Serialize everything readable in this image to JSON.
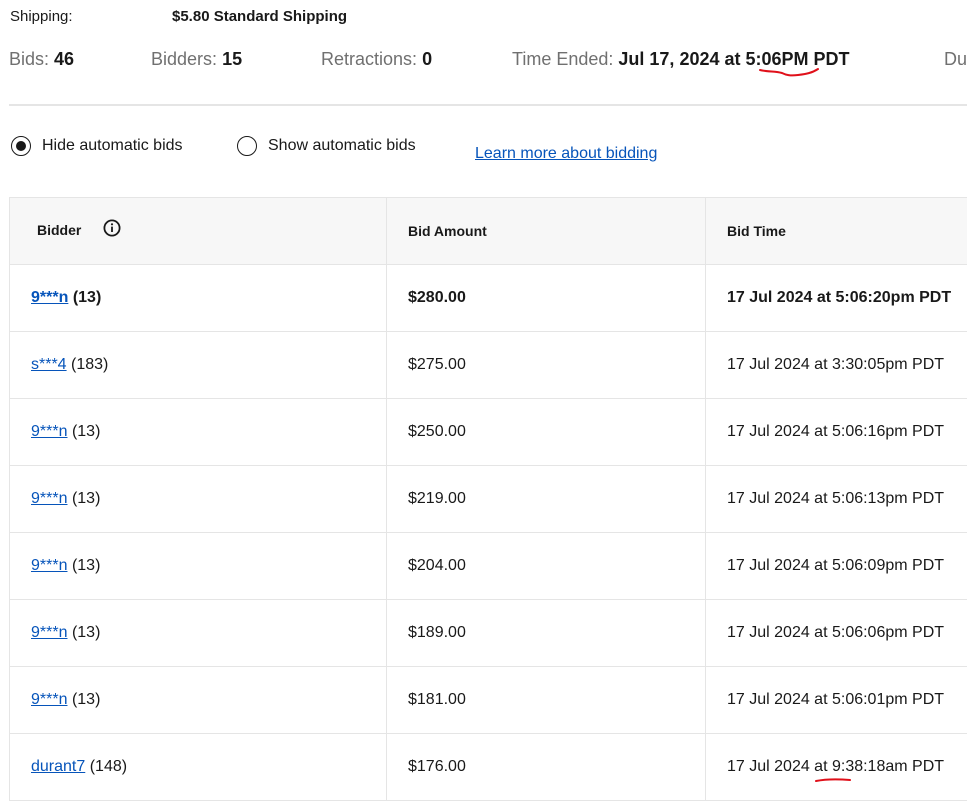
{
  "shipping": {
    "label": "Shipping:",
    "value": "$5.80 Standard Shipping"
  },
  "stats": {
    "bids_label": "Bids:",
    "bids_value": "46",
    "bidders_label": "Bidders:",
    "bidders_value": "15",
    "retractions_label": "Retractions:",
    "retractions_value": "0",
    "time_ended_label": "Time Ended:",
    "time_ended_value": "Jul 17, 2024 at 5:06PM PDT",
    "duration_label": "Du"
  },
  "options": {
    "hide_label": "Hide automatic bids",
    "show_label": "Show automatic bids",
    "selected": "hide",
    "learn_more": "Learn more about bidding"
  },
  "table": {
    "headers": {
      "bidder": "Bidder",
      "amount": "Bid Amount",
      "time": "Bid Time"
    },
    "rows": [
      {
        "bidder": "9***n",
        "score": "(13)",
        "amount": "$280.00",
        "time": "17 Jul 2024 at 5:06:20pm PDT"
      },
      {
        "bidder": "s***4",
        "score": "(183)",
        "amount": "$275.00",
        "time": "17 Jul 2024 at 3:30:05pm PDT"
      },
      {
        "bidder": "9***n",
        "score": "(13)",
        "amount": "$250.00",
        "time": "17 Jul 2024 at 5:06:16pm PDT"
      },
      {
        "bidder": "9***n",
        "score": "(13)",
        "amount": "$219.00",
        "time": "17 Jul 2024 at 5:06:13pm PDT"
      },
      {
        "bidder": "9***n",
        "score": "(13)",
        "amount": "$204.00",
        "time": "17 Jul 2024 at 5:06:09pm PDT"
      },
      {
        "bidder": "9***n",
        "score": "(13)",
        "amount": "$189.00",
        "time": "17 Jul 2024 at 5:06:06pm PDT"
      },
      {
        "bidder": "9***n",
        "score": "(13)",
        "amount": "$181.00",
        "time": "17 Jul 2024 at 5:06:01pm PDT"
      },
      {
        "bidder": "durant7",
        "score": "(148)",
        "amount": "$176.00",
        "time": "17 Jul 2024 at 9:38:18am PDT"
      }
    ]
  },
  "icons": {
    "info": "info-circle-icon",
    "radio_selected": "radio-selected-icon",
    "radio_unselected": "radio-unselected-icon"
  },
  "colors": {
    "link": "#0654ba",
    "label_gray": "#707070",
    "text": "#191919",
    "border": "#e5e5e5",
    "header_bg": "#f7f7f7",
    "annotation_red": "#e0101a"
  }
}
